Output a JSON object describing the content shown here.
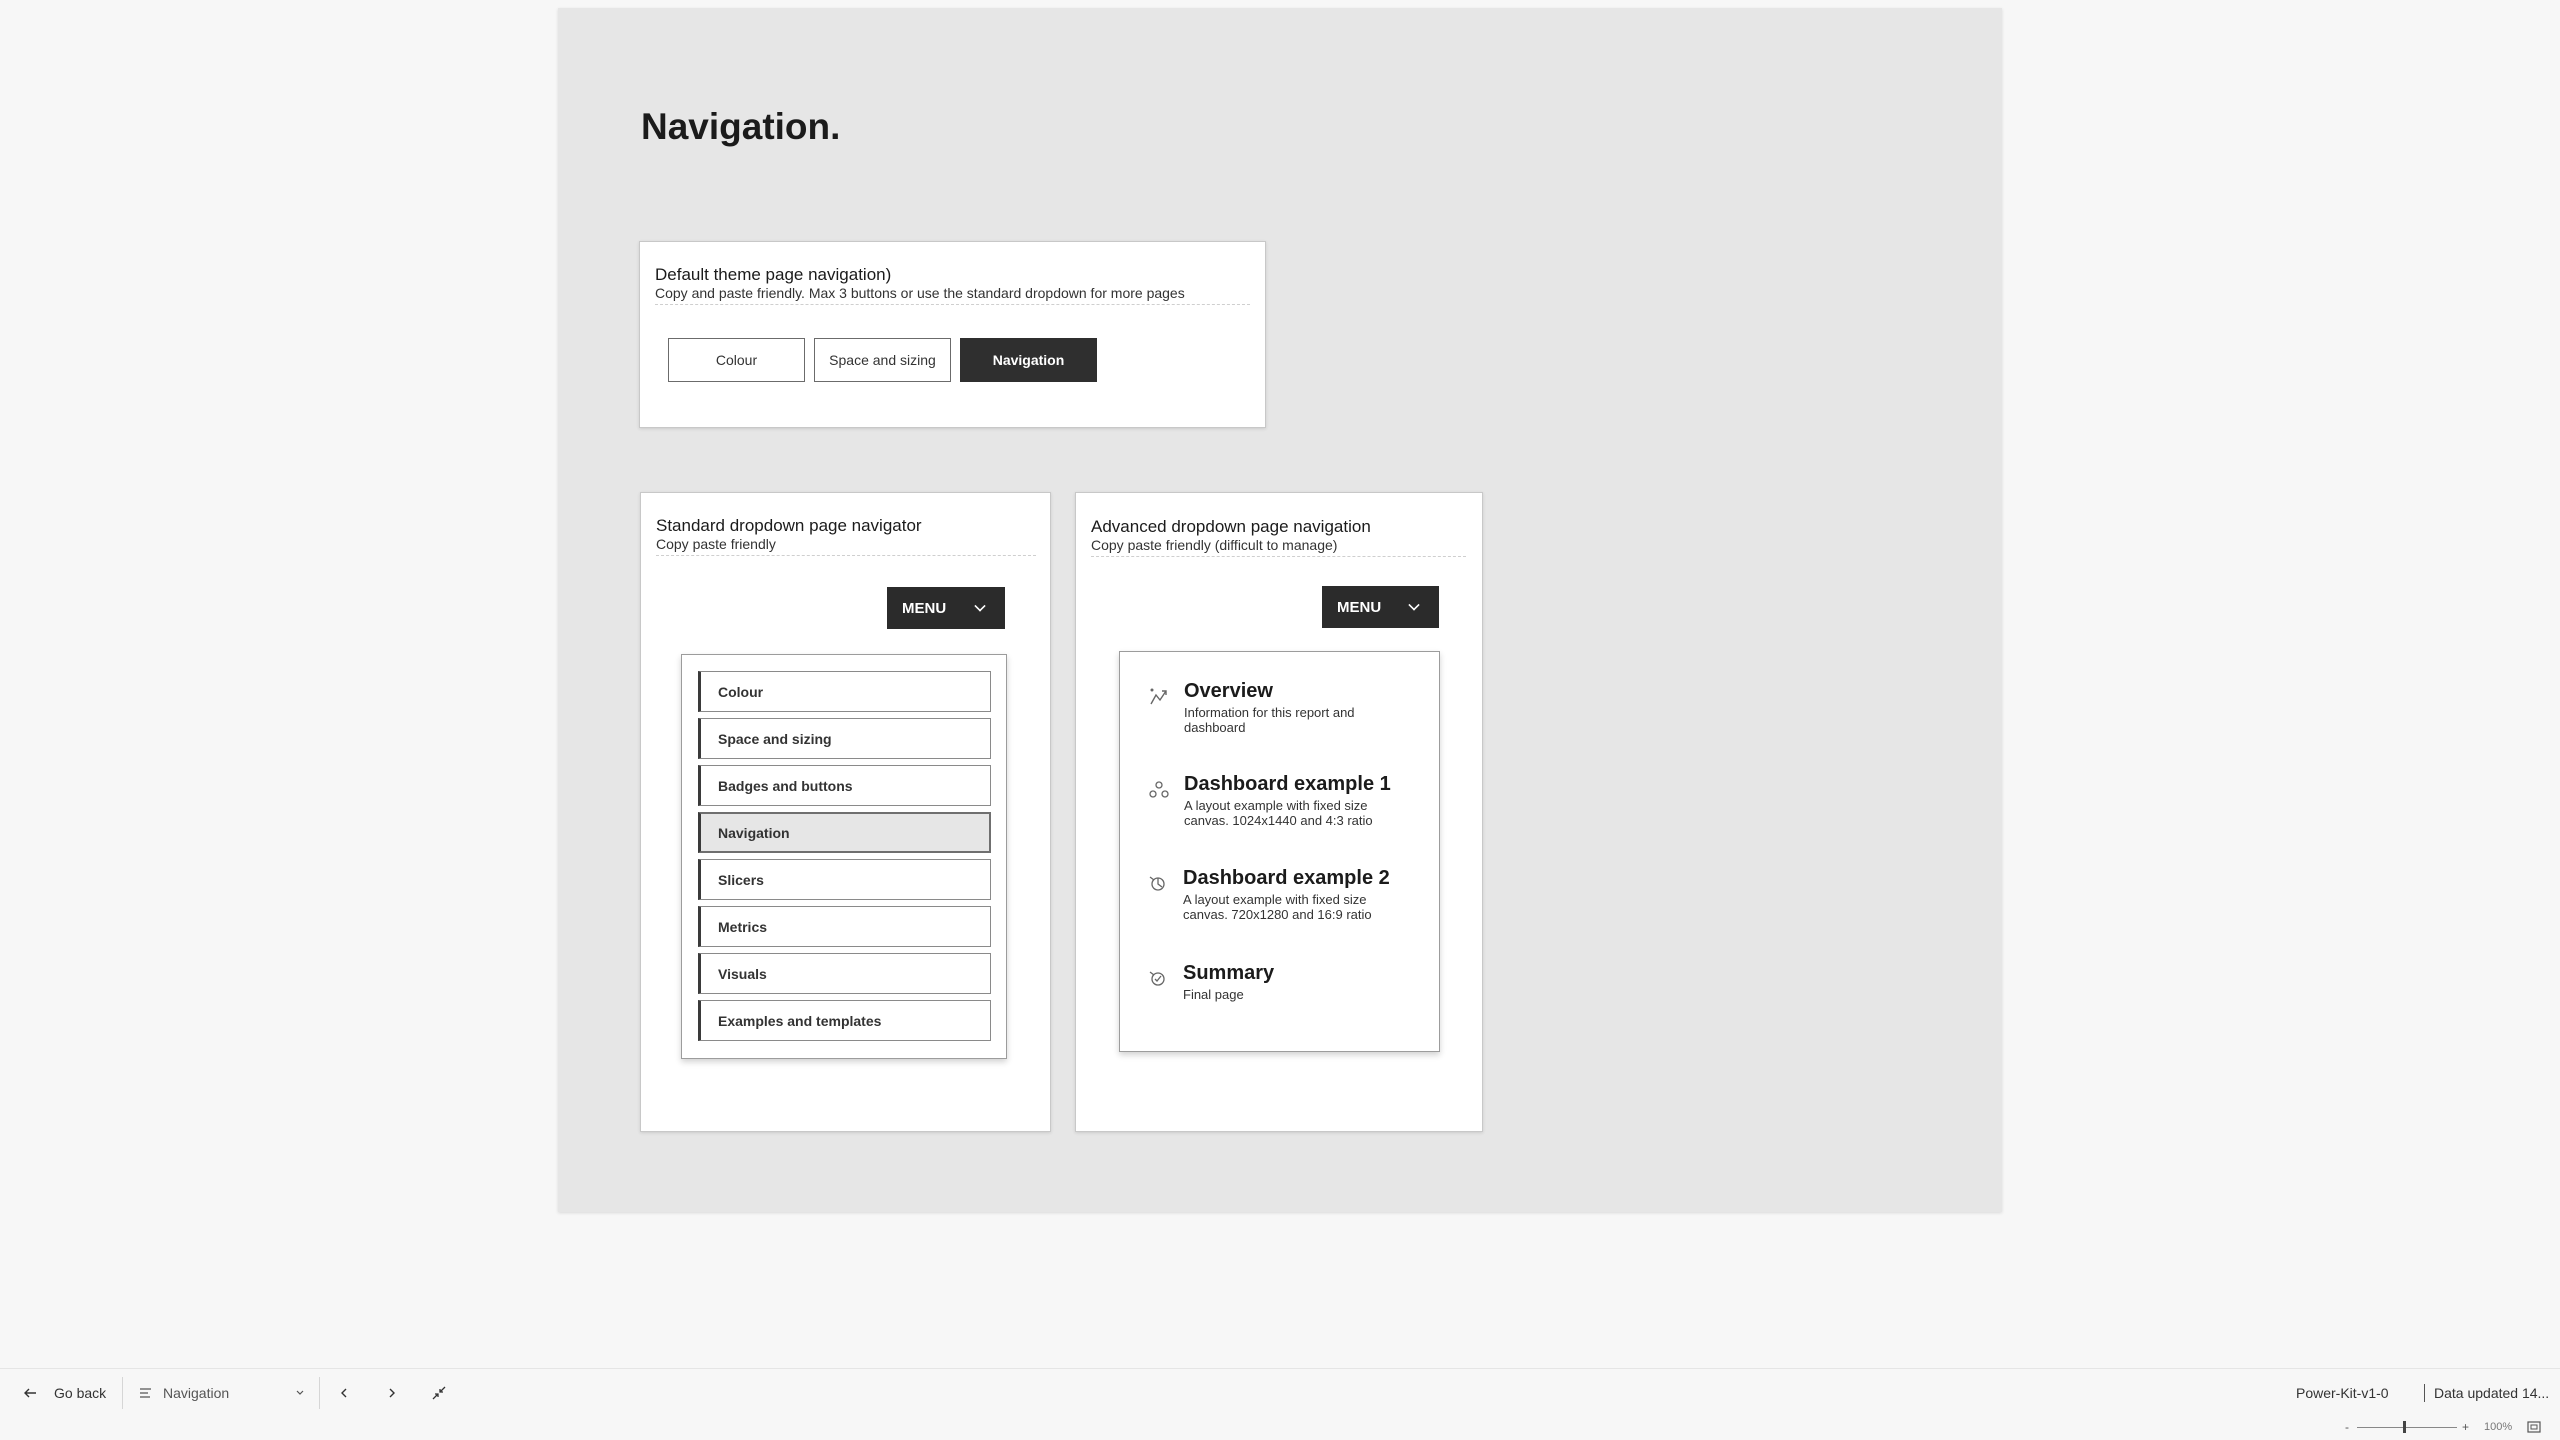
{
  "page": {
    "title": "Navigation."
  },
  "default_nav": {
    "title": "Default theme page navigation)",
    "subtitle": "Copy and paste friendly. Max 3 buttons or use the standard dropdown for more pages",
    "buttons": [
      {
        "label": "Colour",
        "active": false
      },
      {
        "label": "Space and sizing",
        "active": false
      },
      {
        "label": "Navigation",
        "active": true
      }
    ]
  },
  "standard_dropdown": {
    "title": "Standard dropdown page navigator",
    "subtitle": "Copy paste friendly",
    "menu_label": "MENU",
    "items": [
      {
        "label": "Colour"
      },
      {
        "label": "Space and sizing"
      },
      {
        "label": "Badges and buttons"
      },
      {
        "label": "Navigation",
        "selected": true
      },
      {
        "label": "Slicers"
      },
      {
        "label": "Metrics"
      },
      {
        "label": "Visuals"
      },
      {
        "label": "Examples and templates"
      }
    ]
  },
  "advanced_dropdown": {
    "title": "Advanced dropdown page navigation",
    "subtitle": "Copy paste friendly (difficult to manage)",
    "menu_label": "MENU",
    "items": [
      {
        "title": "Overview",
        "desc": "Information for this report and dashboard",
        "icon": "overview-icon"
      },
      {
        "title": "Dashboard example 1",
        "desc": "A layout example with fixed size canvas. 1024x1440 and 4:3 ratio",
        "icon": "dashboard-icon"
      },
      {
        "title": "Dashboard example 2",
        "desc": "A layout example with fixed size canvas. 720x1280 and 16:9 ratio",
        "icon": "dashboard-icon"
      },
      {
        "title": "Summary",
        "desc": "Final page",
        "icon": "summary-icon"
      }
    ]
  },
  "bottom_bar": {
    "go_back": "Go back",
    "current_page": "Navigation",
    "report_name": "Power-Kit-v1-0",
    "data_updated": "Data updated 14..."
  },
  "status_bar": {
    "zoom_minus": "-",
    "zoom_plus": "+",
    "zoom_level": "100%"
  }
}
